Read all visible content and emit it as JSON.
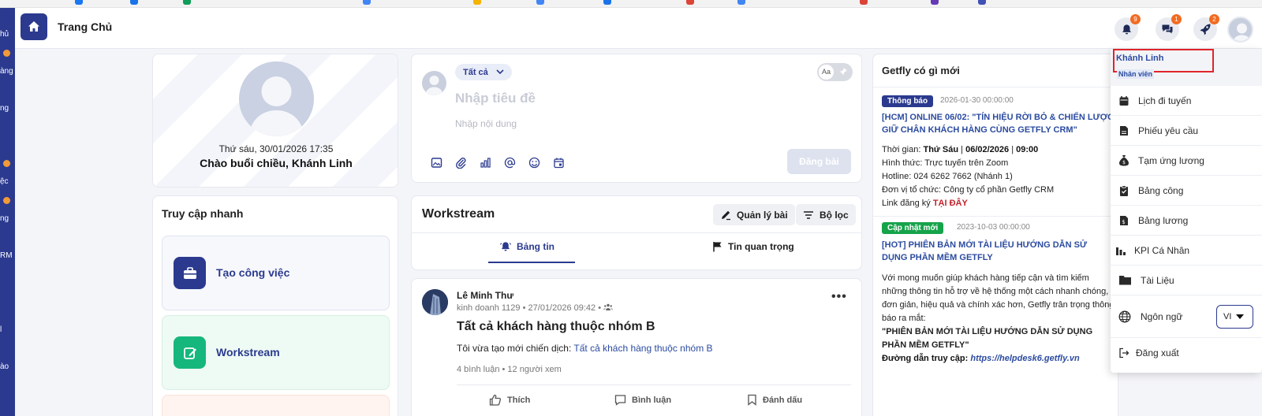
{
  "header": {
    "title": "Trang Chủ",
    "notifications": [
      {
        "icon": "bell-icon",
        "count": "9"
      },
      {
        "icon": "chat-icon",
        "count": "1"
      },
      {
        "icon": "rocket-icon",
        "count": "2"
      }
    ]
  },
  "sidebar": {
    "labels": [
      "hủ",
      "àng",
      "ng",
      "ệc",
      "ng",
      "RM",
      "l",
      "ào"
    ]
  },
  "profile": {
    "date": "Thứ sáu, 30/01/2026 17:35",
    "greeting": "Chào buổi chiều, Khánh Linh"
  },
  "quick_access": {
    "title": "Truy cập nhanh",
    "items": [
      {
        "label": "Tạo công việc",
        "icon": "briefcase-icon",
        "color": "#2b3a8f"
      },
      {
        "label": "Workstream",
        "icon": "edit-icon",
        "color": "#16b77c"
      }
    ]
  },
  "composer": {
    "audience": "Tất cả",
    "toggle_text": "Aa",
    "title_placeholder": "Nhập tiêu đề",
    "content_placeholder": "Nhập nội dung",
    "post_label": "Đăng bài",
    "tools": [
      "image-icon",
      "attach-icon",
      "chart-icon",
      "mention-icon",
      "emoji-icon",
      "calendar-icon"
    ]
  },
  "workstream": {
    "title": "Workstream",
    "manage_label": "Quản lý bài",
    "filter_label": "Bộ lọc",
    "tabs": [
      {
        "label": "Bảng tin",
        "icon": "bell-icon",
        "active": true
      },
      {
        "label": "Tin quan trọng",
        "icon": "flag-icon",
        "active": false
      }
    ]
  },
  "post": {
    "author": "Lê Minh Thư",
    "group": "kinh doanh 1129",
    "time": "27/01/2026 09:42",
    "heading": "Tất cả khách hàng thuộc nhóm B",
    "body_prefix": "Tôi vừa tạo mới chiến dịch:",
    "body_link": "Tất cả khách hàng thuộc nhóm B",
    "comments": "4 bình luận",
    "views": "12 người xem",
    "actions": [
      "Thích",
      "Bình luận",
      "Đánh dấu"
    ]
  },
  "news": {
    "title": "Getfly có gì mới",
    "items": [
      {
        "badge": "Thông báo",
        "badge_color": "#2b3a8f",
        "date": "2026-01-30 00:00:00",
        "headline": "[HCM] ONLINE 06/02: \"TÍN HIỆU RỜI BỎ & CHIẾN LƯỢC GIỮ CHÂN KHÁCH HÀNG CÙNG GETFLY CRM\"",
        "time_label": "Thời gian:",
        "time_day": "Thứ Sáu",
        "time_date": "06/02/2026",
        "time_hour": "09:00",
        "format": "Hình thức: Trực tuyến trên Zoom",
        "hotline": "Hotline: 024 6262 7662 (Nhánh 1)",
        "organizer": "Đơn vị tổ chức: Công ty cổ phần Getfly CRM",
        "register_prefix": "Link đăng ký",
        "register_link": "TẠI ĐÂY"
      },
      {
        "badge": "Cập nhật mới",
        "badge_color": "#16a34a",
        "date": "2023-10-03 00:00:00",
        "headline": "[HOT] PHIÊN BẢN MỚI TÀI LIỆU HƯỚNG DẪN SỬ DỤNG PHẦN MỀM GETFLY",
        "body": "Với mong muốn giúp khách hàng tiếp cận và tìm kiếm những thông tin hỗ trợ về hệ thống một cách nhanh chóng, đơn giản, hiệu quả và chính xác hơn, Getfly trân trọng thông báo ra mắt:",
        "quote": "\"PHIÊN BẢN MỚI TÀI LIỆU HƯỚNG DẪN SỬ DỤNG PHẦN MỀM GETFLY\"",
        "link_prefix": "Đường dẫn truy cập:",
        "link": "https://helpdesk6.getfly.vn"
      }
    ]
  },
  "user_menu": {
    "name": "Khánh Linh",
    "role": "Nhân viên",
    "items": [
      {
        "label": "Lịch đi tuyến",
        "icon": "calendar-icon"
      },
      {
        "label": "Phiếu yêu cầu",
        "icon": "document-icon"
      },
      {
        "label": "Tạm ứng lương",
        "icon": "money-bag-icon"
      },
      {
        "label": "Bảng công",
        "icon": "clipboard-icon"
      },
      {
        "label": "Bảng lương",
        "icon": "payslip-icon"
      },
      {
        "label": "KPI Cá Nhân",
        "icon": "kpi-chart-icon"
      },
      {
        "label": "Tài Liệu",
        "icon": "folder-icon"
      },
      {
        "label": "Ngôn ngữ",
        "icon": "globe-icon"
      },
      {
        "label": "Đăng xuất",
        "icon": "logout-icon"
      }
    ],
    "language": "VI"
  }
}
